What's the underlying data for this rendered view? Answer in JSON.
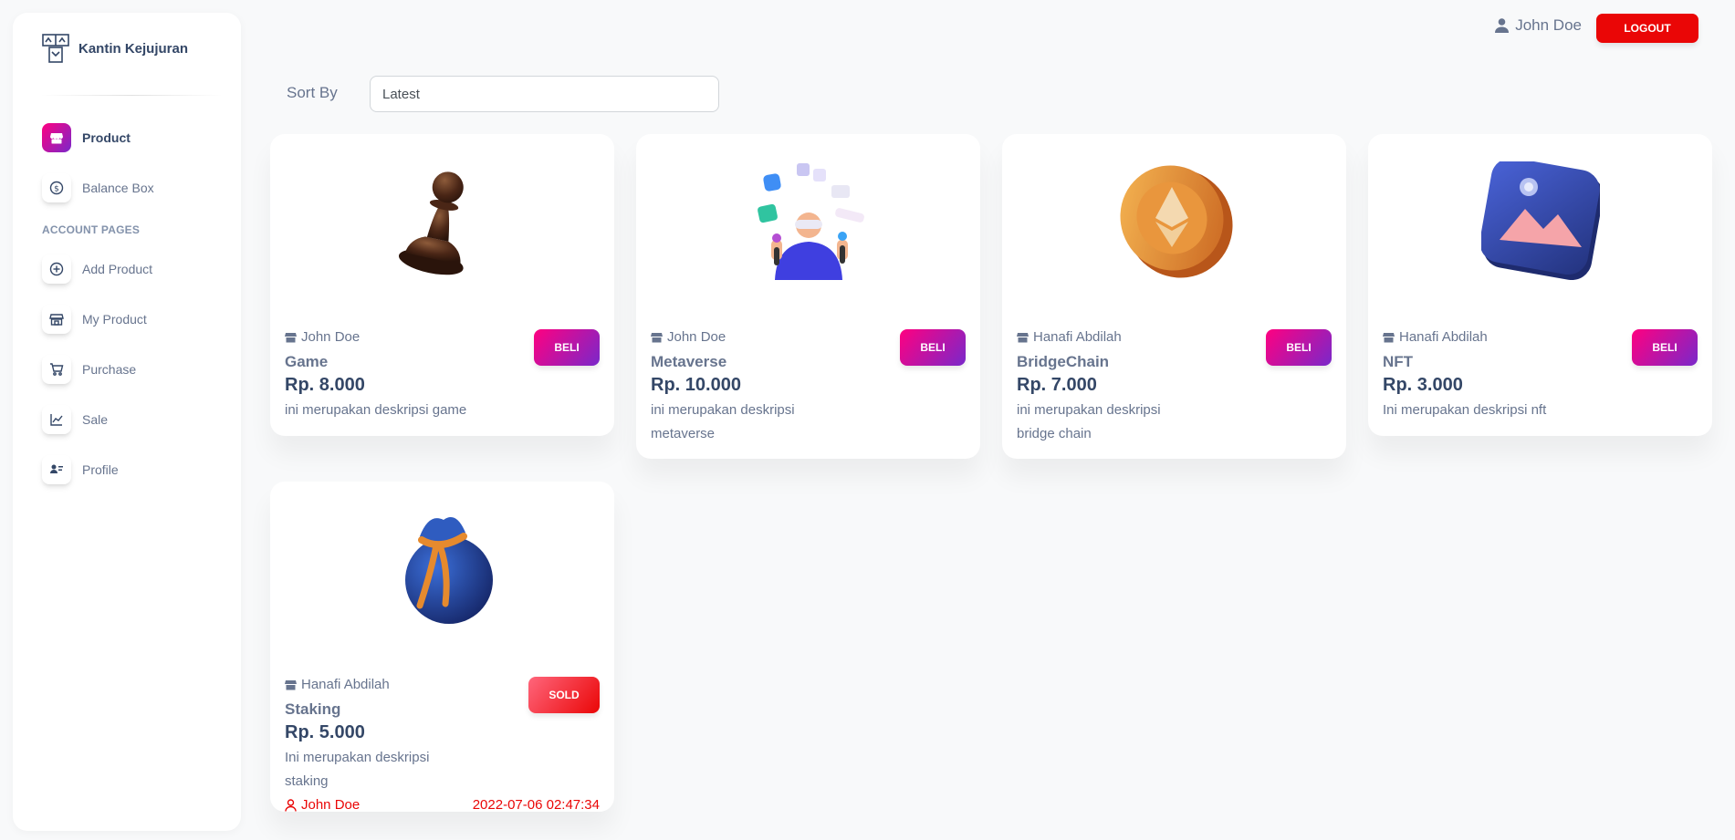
{
  "sidebar": {
    "brand": "Kantin Kejujuran",
    "items": [
      {
        "label": "Product",
        "icon": "shop-icon"
      },
      {
        "label": "Balance Box",
        "icon": "coin-icon"
      }
    ],
    "section_title": "ACCOUNT PAGES",
    "account_items": [
      {
        "label": "Add Product",
        "icon": "plus-circle-icon"
      },
      {
        "label": "My Product",
        "icon": "store-icon"
      },
      {
        "label": "Purchase",
        "icon": "cart-icon"
      },
      {
        "label": "Sale",
        "icon": "chart-line-icon"
      },
      {
        "label": "Profile",
        "icon": "user-card-icon"
      }
    ]
  },
  "header": {
    "user_name": "John Doe",
    "logout_label": "LOGOUT"
  },
  "sort": {
    "label": "Sort By",
    "value": "Latest"
  },
  "products": [
    {
      "seller": "John Doe",
      "name": "Game",
      "price": "Rp. 8.000",
      "description": "ini merupakan deskripsi game",
      "action": "BELI",
      "image": "chess-pawn-image"
    },
    {
      "seller": "John Doe",
      "name": "Metaverse",
      "price": "Rp. 10.000",
      "description": "ini merupakan deskripsi metaverse",
      "action": "BELI",
      "image": "metaverse-person-image"
    },
    {
      "seller": "Hanafi Abdilah",
      "name": "BridgeChain",
      "price": "Rp. 7.000",
      "description": "ini merupakan deskripsi bridge chain",
      "action": "BELI",
      "image": "gold-coin-image"
    },
    {
      "seller": "Hanafi Abdilah",
      "name": "NFT",
      "price": "Rp. 3.000",
      "description": "Ini merupakan deskripsi nft",
      "action": "BELI",
      "image": "picture-frame-image"
    },
    {
      "seller": "Hanafi Abdilah",
      "name": "Staking",
      "price": "Rp. 5.000",
      "description": "Ini merupakan deskripsi staking",
      "action": "SOLD",
      "buyer": "John Doe",
      "sold_at": "2022-07-06 02:47:34",
      "image": "money-bag-image"
    }
  ],
  "colors": {
    "accent_gradient_start": "#7928ca",
    "accent_gradient_end": "#ff0080",
    "danger": "#ea0606",
    "text_dark": "#344767",
    "text_muted": "#67748e"
  }
}
